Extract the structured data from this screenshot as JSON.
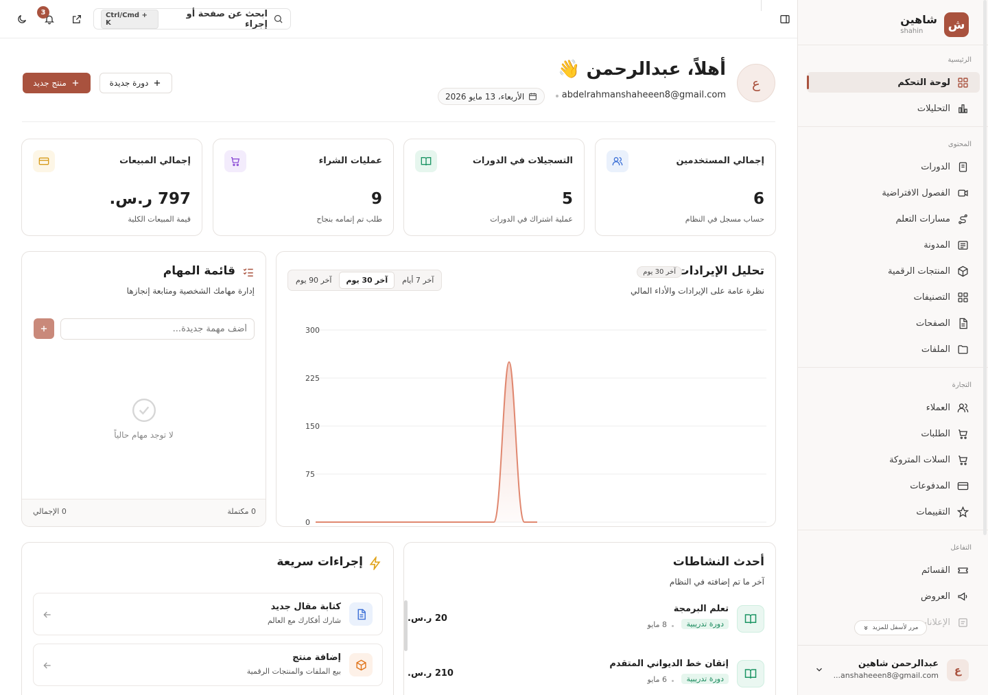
{
  "sidebar": {
    "brand_logo": "ش",
    "brand_name": "شاهين",
    "brand_sub": "shahin",
    "sections": [
      {
        "label": "الرئيسية"
      },
      {
        "label": "المحتوى"
      },
      {
        "label": "التجارة"
      },
      {
        "label": "التفاعل"
      }
    ],
    "items": [
      {
        "label": "لوحة التحكم",
        "icon": "dashboard-icon"
      },
      {
        "label": "التحليلات",
        "icon": "analytics-icon"
      },
      {
        "label": "الدورات",
        "icon": "book-icon"
      },
      {
        "label": "الفصول الافتراضية",
        "icon": "video-icon"
      },
      {
        "label": "مسارات التعلم",
        "icon": "route-icon"
      },
      {
        "label": "المدونة",
        "icon": "blog-icon"
      },
      {
        "label": "المنتجات الرقمية",
        "icon": "package-icon"
      },
      {
        "label": "التصنيفات",
        "icon": "categories-icon"
      },
      {
        "label": "الصفحات",
        "icon": "page-icon"
      },
      {
        "label": "الملفات",
        "icon": "folder-icon"
      },
      {
        "label": "العملاء",
        "icon": "users-icon"
      },
      {
        "label": "الطلبات",
        "icon": "cart-icon"
      },
      {
        "label": "السلات المتروكة",
        "icon": "cart-icon"
      },
      {
        "label": "المدفوعات",
        "icon": "card-icon"
      },
      {
        "label": "التقييمات",
        "icon": "star-icon"
      },
      {
        "label": "القسائم",
        "icon": "ticket-icon"
      },
      {
        "label": "العروض",
        "icon": "megaphone-icon"
      },
      {
        "label": "الإعلانات",
        "icon": "announcement-icon"
      }
    ],
    "scroll_hint": "مرر لأسفل للمزيد",
    "user": {
      "avatar": "ع",
      "name": "عبدالرحمن شاهين",
      "email": "...anshaheeen8@gmail.com"
    }
  },
  "topbar": {
    "search_placeholder": "ابحث عن صفحة أو إجراء",
    "shortcut": "Ctrl/Cmd + K",
    "notifications_count": "3"
  },
  "header": {
    "avatar": "ع",
    "greeting": "أهلاً، عبدالرحمن 👋",
    "email": "abdelrahmanshaheeen8@gmail.com",
    "date": "الأربعاء، 13 مايو 2026",
    "new_course": "دورة جديدة",
    "new_product": "منتج جديد"
  },
  "stats": [
    {
      "title": "إجمالي المستخدمين",
      "value": "6",
      "sub": "حساب مسجل في النظام",
      "icon": "users-icon",
      "color": "#3b6fd6",
      "bg": "#eaf1fc"
    },
    {
      "title": "التسجيلات في الدورات",
      "value": "5",
      "sub": "عملية اشتراك في الدورات",
      "icon": "book-open-icon",
      "color": "#1a9463",
      "bg": "#e6f6ee"
    },
    {
      "title": "عمليات الشراء",
      "value": "9",
      "sub": "طلب تم إتمامه بنجاح",
      "icon": "cart-icon",
      "color": "#8d4fd6",
      "bg": "#f3ecfc"
    },
    {
      "title": "إجمالي المبيعات",
      "value": "797 ر.س.",
      "sub": "قيمة المبيعات الكلية",
      "icon": "wallet-icon",
      "color": "#d69a1a",
      "bg": "#fdf6e6"
    }
  ],
  "revenue": {
    "title": "تحليل الإيرادات",
    "badge": "آخر 30 يوم",
    "subtitle": "نظرة عامة على الإيرادات والأداء المالي",
    "tabs": [
      "آخر 7 أيام",
      "آخر 30 يوم",
      "آخر 90 يوم"
    ],
    "active_tab": 1
  },
  "chart_data": {
    "type": "area",
    "x": [
      0,
      1,
      2,
      3,
      4,
      5,
      6,
      7,
      8,
      9,
      10,
      11,
      12,
      13,
      14,
      15,
      16,
      17,
      18,
      19,
      20,
      21,
      22,
      23,
      24,
      25,
      26,
      27,
      28,
      29,
      30,
      31,
      32,
      33,
      34,
      35,
      36,
      37,
      38,
      39,
      40,
      41,
      42,
      43,
      44,
      45,
      46,
      47,
      48,
      49,
      50,
      51,
      52,
      53,
      54,
      55,
      56,
      57,
      58,
      59
    ],
    "values": [
      0,
      0,
      0,
      0,
      0,
      0,
      0,
      0,
      0,
      0,
      0,
      0,
      0,
      0,
      0,
      0,
      0,
      0,
      0,
      0,
      0,
      0,
      0,
      0,
      0,
      0,
      0,
      0,
      0,
      0,
      0,
      0,
      0,
      0,
      0,
      0,
      0,
      0,
      0,
      0,
      0,
      0,
      0,
      0,
      0,
      0,
      0,
      0,
      0,
      0,
      0,
      0,
      0,
      0,
      0,
      0,
      0,
      0,
      0,
      0
    ],
    "peak_value": 250,
    "yticks": [
      "300",
      "225",
      "150",
      "75",
      "0"
    ],
    "ylim": [
      0,
      300
    ],
    "grid": true,
    "color": "#e0876f"
  },
  "tasks": {
    "title": "قائمة المهام",
    "subtitle": "إدارة مهامك الشخصية ومتابعة إنجازها",
    "input_placeholder": "أضف مهمة جديدة...",
    "empty": "لا توجد مهام حالياً",
    "completed": "0 مكتملة",
    "total": "0 الإجمالي"
  },
  "activity": {
    "title": "أحدث النشاطات",
    "subtitle": "آخر ما تم إضافته في النظام",
    "items": [
      {
        "title": "تعلم البرمجة",
        "badge": "دورة تدريبية",
        "date": "8 مايو",
        "price": "20 ر.س."
      },
      {
        "title": "إتقان خط الديواني المتقدم",
        "badge": "دورة تدريبية",
        "date": "6 مايو",
        "price": "210 ر.س."
      }
    ]
  },
  "quick": {
    "title": "إجراءات سريعة",
    "items": [
      {
        "title": "كتابة مقال جديد",
        "sub": "شارك أفكارك مع العالم",
        "icon": "document-icon"
      },
      {
        "title": "إضافة منتج",
        "sub": "بيع الملفات والمنتجات الرقمية",
        "icon": "package-icon"
      }
    ]
  }
}
